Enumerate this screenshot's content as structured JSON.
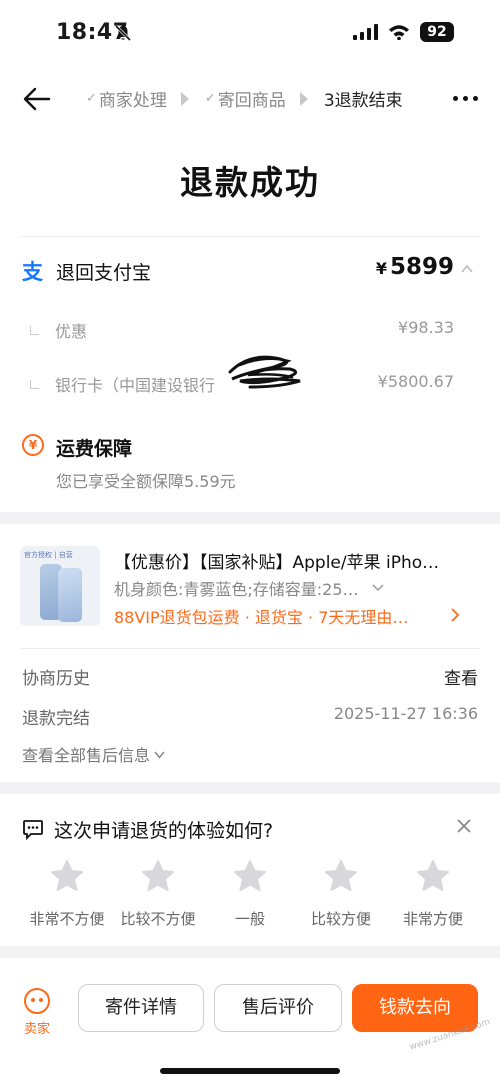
{
  "status_bar": {
    "time": "18:47",
    "battery": "92"
  },
  "nav": {
    "steps": [
      {
        "label": "商家处理",
        "done": true
      },
      {
        "label": "寄回商品",
        "done": true
      },
      {
        "label": "3退款结束",
        "done": false
      }
    ]
  },
  "refund": {
    "title": "退款成功",
    "method_label": "退回支付宝",
    "currency": "¥",
    "amount": "5899",
    "details": [
      {
        "label": "优惠",
        "value": "¥98.33"
      },
      {
        "label": "银行卡（中国建设银行",
        "value": "¥5800.67"
      }
    ],
    "freight_title": "运费保障",
    "freight_desc": "您已享受全额保障5.59元",
    "freight_icon_glyph": "¥"
  },
  "product": {
    "badge": "官方授权 | 自营",
    "title": "【优惠价】【国家补贴】Apple/苹果 iPho…",
    "spec": "机身颜色:青雾蓝色;存储容量:25…",
    "tags": "88VIP退货包运费 · 退货宝 · 7天无理由…",
    "rows": [
      {
        "label": "协商历史",
        "value": "查看"
      },
      {
        "label": "退款完结",
        "value": "2025-11-27 16:36"
      }
    ],
    "view_all": "查看全部售后信息"
  },
  "survey": {
    "question": "这次申请退货的体验如何?",
    "options": [
      "非常不方便",
      "比较不方便",
      "一般",
      "比较方便",
      "非常方便"
    ]
  },
  "bottom": {
    "seller_label": "卖家",
    "buttons": [
      "寄件详情",
      "售后评价",
      "钱款去向"
    ]
  },
  "watermark": "www.zuanke8.com",
  "colors": {
    "accent": "#ff6512",
    "alipay": "#1677ff"
  },
  "icons": [
    "back-arrow-icon",
    "more-icon",
    "alipay-icon",
    "chevron-up-icon",
    "freight-icon",
    "chat-icon",
    "close-icon",
    "star-icon",
    "seller-icon"
  ]
}
